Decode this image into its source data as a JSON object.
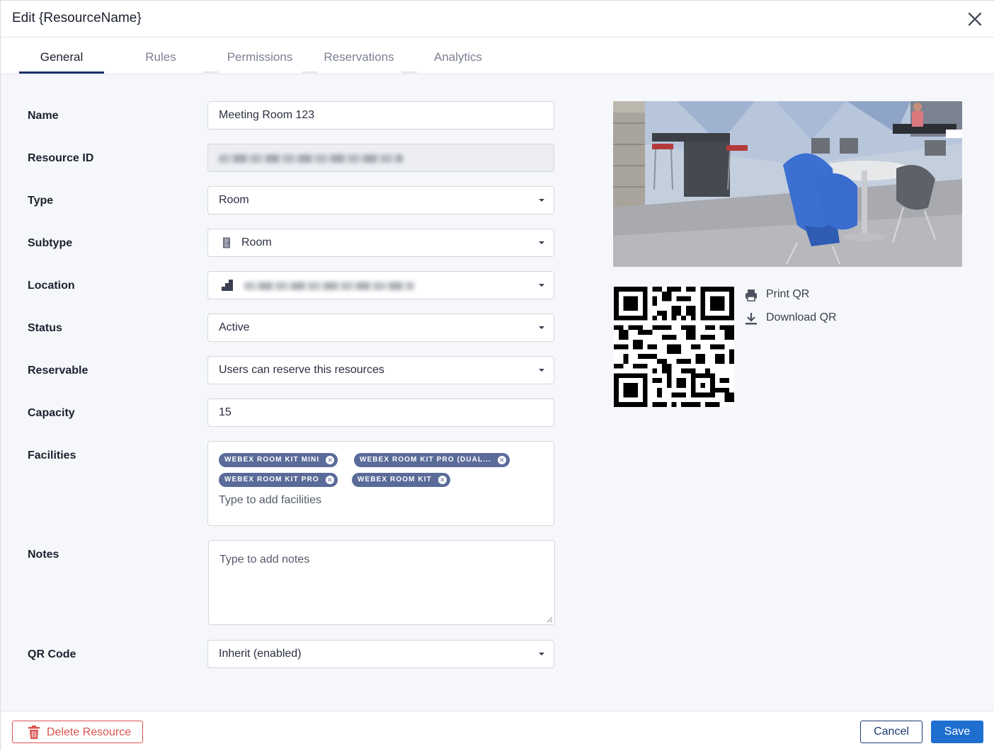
{
  "header": {
    "title": "Edit {ResourceName}"
  },
  "tabs": [
    {
      "label": "General",
      "active": true
    },
    {
      "label": "Rules",
      "active": false
    },
    {
      "label": "Permissions",
      "active": false
    },
    {
      "label": "Reservations",
      "active": false
    },
    {
      "label": "Analytics",
      "active": false
    }
  ],
  "form": {
    "name": {
      "label": "Name",
      "value": "Meeting Room 123"
    },
    "resource_id": {
      "label": "Resource ID",
      "value_redacted": true
    },
    "type": {
      "label": "Type",
      "value": "Room"
    },
    "subtype": {
      "label": "Subtype",
      "value": "Room",
      "icon": "door-icon"
    },
    "location": {
      "label": "Location",
      "value_redacted": true,
      "icon": "building-icon"
    },
    "status": {
      "label": "Status",
      "value": "Active"
    },
    "reservable": {
      "label": "Reservable",
      "value": "Users can reserve this resources"
    },
    "capacity": {
      "label": "Capacity",
      "value": "15"
    },
    "facilities": {
      "label": "Facilities",
      "tags": [
        "WEBEX ROOM KIT MINI",
        "WEBEX ROOM KIT PRO (DUAL...",
        "WEBEX ROOM KIT PRO",
        "WEBEX ROOM KIT"
      ],
      "placeholder": "Type to add facilities"
    },
    "notes": {
      "label": "Notes",
      "placeholder": "Type to add notes"
    },
    "qr_code": {
      "label": "QR Code",
      "value": "Inherit (enabled)"
    }
  },
  "qr_actions": {
    "print": "Print QR",
    "download": "Download QR"
  },
  "footer": {
    "delete": "Delete Resource",
    "cancel": "Cancel",
    "save": "Save"
  },
  "colors": {
    "primary": "#1f6fd1",
    "navy": "#1d3a73",
    "danger": "#d9534f",
    "chip": "#5a6b99"
  }
}
